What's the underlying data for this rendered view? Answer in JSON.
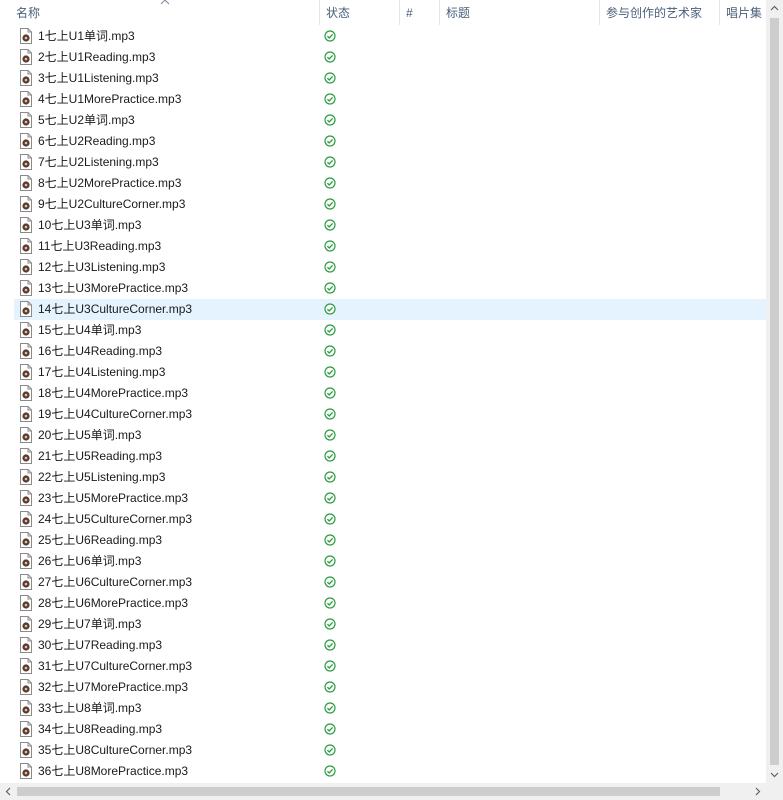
{
  "columns": {
    "name": "名称",
    "status": "状态",
    "number": "#",
    "title": "标题",
    "artists": "参与创作的艺术家",
    "album": "唱片集"
  },
  "selected_index": 13,
  "colors": {
    "selected_row": "#e5f3ff",
    "status_ok": "#2a9d3e",
    "header_text": "#4c607a"
  },
  "files": [
    {
      "name": "1七上U1单词.mp3",
      "status_icon": "synced-check-icon"
    },
    {
      "name": "2七上U1Reading.mp3",
      "status_icon": "synced-check-icon"
    },
    {
      "name": "3七上U1Listening.mp3",
      "status_icon": "synced-check-icon"
    },
    {
      "name": "4七上U1MorePractice.mp3",
      "status_icon": "synced-check-icon"
    },
    {
      "name": "5七上U2单词.mp3",
      "status_icon": "synced-check-icon"
    },
    {
      "name": "6七上U2Reading.mp3",
      "status_icon": "synced-check-icon"
    },
    {
      "name": "7七上U2Listening.mp3",
      "status_icon": "synced-check-icon"
    },
    {
      "name": "8七上U2MorePractice.mp3",
      "status_icon": "synced-check-icon"
    },
    {
      "name": "9七上U2CultureCorner.mp3",
      "status_icon": "synced-check-icon"
    },
    {
      "name": "10七上U3单词.mp3",
      "status_icon": "synced-check-icon"
    },
    {
      "name": "11七上U3Reading.mp3",
      "status_icon": "synced-check-icon"
    },
    {
      "name": "12七上U3Listening.mp3",
      "status_icon": "synced-check-icon"
    },
    {
      "name": "13七上U3MorePractice.mp3",
      "status_icon": "synced-check-icon"
    },
    {
      "name": "14七上U3CultureCorner.mp3",
      "status_icon": "synced-check-icon"
    },
    {
      "name": "15七上U4单词.mp3",
      "status_icon": "synced-check-icon"
    },
    {
      "name": "16七上U4Reading.mp3",
      "status_icon": "synced-check-icon"
    },
    {
      "name": "17七上U4Listening.mp3",
      "status_icon": "synced-check-icon"
    },
    {
      "name": "18七上U4MorePractice.mp3",
      "status_icon": "synced-check-icon"
    },
    {
      "name": "19七上U4CultureCorner.mp3",
      "status_icon": "synced-check-icon"
    },
    {
      "name": "20七上U5单词.mp3",
      "status_icon": "synced-check-icon"
    },
    {
      "name": "21七上U5Reading.mp3",
      "status_icon": "synced-check-icon"
    },
    {
      "name": "22七上U5Listening.mp3",
      "status_icon": "synced-check-icon"
    },
    {
      "name": "23七上U5MorePractice.mp3",
      "status_icon": "synced-check-icon"
    },
    {
      "name": "24七上U5CultureCorner.mp3",
      "status_icon": "synced-check-icon"
    },
    {
      "name": "25七上U6Reading.mp3",
      "status_icon": "synced-check-icon"
    },
    {
      "name": "26七上U6单词.mp3",
      "status_icon": "synced-check-icon"
    },
    {
      "name": "27七上U6CultureCorner.mp3",
      "status_icon": "synced-check-icon"
    },
    {
      "name": "28七上U6MorePractice.mp3",
      "status_icon": "synced-check-icon"
    },
    {
      "name": "29七上U7单词.mp3",
      "status_icon": "synced-check-icon"
    },
    {
      "name": "30七上U7Reading.mp3",
      "status_icon": "synced-check-icon"
    },
    {
      "name": "31七上U7CultureCorner.mp3",
      "status_icon": "synced-check-icon"
    },
    {
      "name": "32七上U7MorePractice.mp3",
      "status_icon": "synced-check-icon"
    },
    {
      "name": "33七上U8单词.mp3",
      "status_icon": "synced-check-icon"
    },
    {
      "name": "34七上U8Reading.mp3",
      "status_icon": "synced-check-icon"
    },
    {
      "name": "35七上U8CultureCorner.mp3",
      "status_icon": "synced-check-icon"
    },
    {
      "name": "36七上U8MorePractice.mp3",
      "status_icon": "synced-check-icon"
    }
  ]
}
